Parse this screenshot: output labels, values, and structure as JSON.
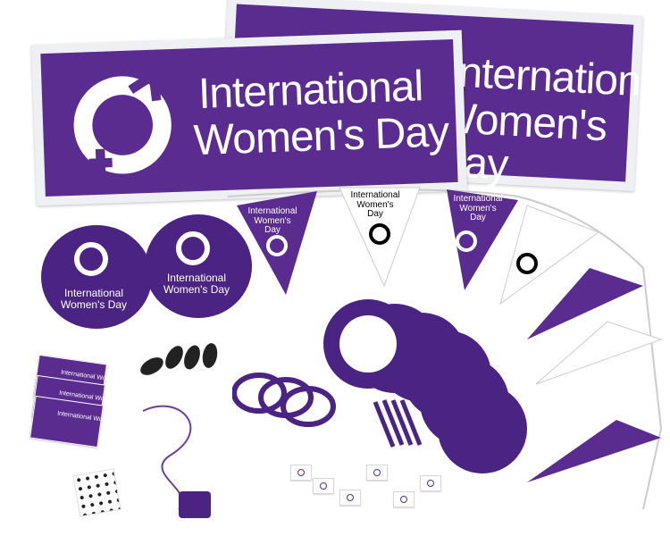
{
  "colors": {
    "purple": "#5b2c8f",
    "white": "#ffffff",
    "banner_border": "#eef0f3"
  },
  "banners": {
    "front": {
      "line1": "International",
      "line2": "Women's Day"
    },
    "back": {
      "line1": "International",
      "line2": "Women's Day"
    }
  },
  "bunting": {
    "flag_text": "International Women's Day",
    "flag_line1": "International",
    "flag_line2": "Women's",
    "flag_line3": "Day"
  },
  "balloons": {
    "line1": "International",
    "line2": "Women's Day"
  },
  "cards": {
    "text": "International Women's Day"
  },
  "icons": [
    "venus-symbol-logo"
  ]
}
